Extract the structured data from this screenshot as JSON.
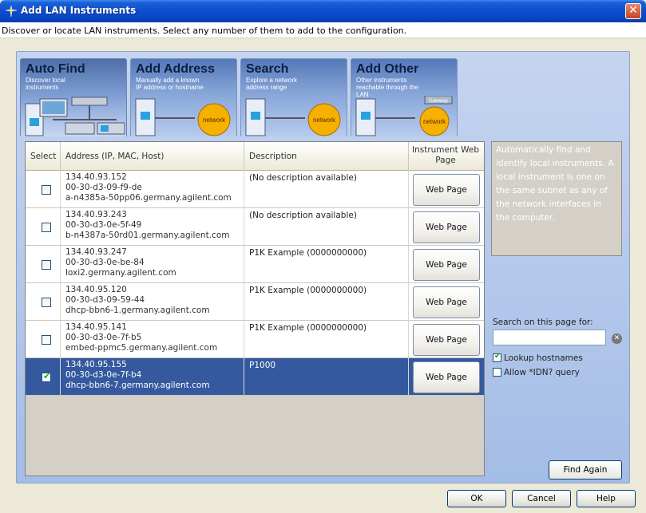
{
  "window": {
    "title": "Add LAN Instruments",
    "subtitle": "Discover or locate LAN instruments. Select any number of them to add to the configuration."
  },
  "tabs": [
    {
      "title": "Auto Find",
      "sub": "Discover local instruments",
      "active": true
    },
    {
      "title": "Add Address",
      "sub": "Manually add a known IP address or hostname"
    },
    {
      "title": "Search",
      "sub": "Explore a network address range"
    },
    {
      "title": "Add Other",
      "sub": "Other instruments reachable through the LAN"
    }
  ],
  "tab_images": {
    "network_label": "network",
    "gateway_label": "Gateway"
  },
  "table": {
    "headers": {
      "select": "Select",
      "address": "Address (IP, MAC, Host)",
      "description": "Description",
      "webpage": "Instrument Web Page"
    },
    "rows": [
      {
        "ip": "134.40.93.152",
        "mac": "00-30-d3-09-f9-de",
        "host": "a-n4385a-50pp06.germany.agilent.com",
        "desc": "(No description available)",
        "btn": "Web Page",
        "checked": false
      },
      {
        "ip": "134.40.93.243",
        "mac": "00-30-d3-0e-5f-49",
        "host": "b-n4387a-50rd01.germany.agilent.com",
        "desc": "(No description available)",
        "btn": "Web Page",
        "checked": false
      },
      {
        "ip": "134.40.93.247",
        "mac": "00-30-d3-0e-be-84",
        "host": "loxi2.germany.agilent.com",
        "desc": "P1K Example (0000000000)",
        "btn": "Web Page",
        "checked": false
      },
      {
        "ip": "134.40.95.120",
        "mac": "00-30-d3-09-59-44",
        "host": "dhcp-bbn6-1.germany.agilent.com",
        "desc": "P1K Example (0000000000)",
        "btn": "Web Page",
        "checked": false
      },
      {
        "ip": "134.40.95.141",
        "mac": "00-30-d3-0e-7f-b5",
        "host": "embed-ppmc5.germany.agilent.com",
        "desc": "P1K Example (0000000000)",
        "btn": "Web Page",
        "checked": false
      },
      {
        "ip": "134.40.95.155",
        "mac": "00-30-d3-0e-7f-b4",
        "host": "dhcp-bbn6-7.germany.agilent.com",
        "desc": "P1000",
        "btn": "Web Page",
        "checked": true
      }
    ]
  },
  "info_text": "Automatically find and identify local instruments. A local instrument is one on the same subnet as any of the network interfaces in the computer.",
  "search": {
    "label": "Search on this page for:",
    "value": ""
  },
  "options": [
    {
      "label": "Lookup hostnames",
      "checked": true
    },
    {
      "label": "Allow *IDN? query",
      "checked": false
    }
  ],
  "buttons": {
    "find_again": "Find Again",
    "ok": "OK",
    "cancel": "Cancel",
    "help": "Help"
  },
  "colors": {
    "title_bar": "#0a4fd0",
    "panel": "#a4bde6",
    "selected_row": "#35599f"
  }
}
